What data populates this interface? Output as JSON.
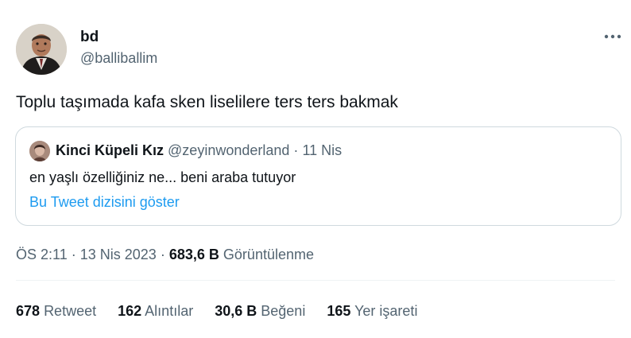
{
  "author": {
    "name": "bd",
    "handle": "@balliballim"
  },
  "tweet": {
    "text": "Toplu taşımada kafa sken liselilere ters ters bakmak"
  },
  "quoted": {
    "name": "Kinci Küpeli Kız",
    "handle": "@zeyinwonderland",
    "separator": "·",
    "date": "11 Nis",
    "text": "en yaşlı özelliğiniz ne... beni araba tutuyor",
    "thread_link": "Bu Tweet dizisini göster"
  },
  "meta": {
    "time": "ÖS 2:11",
    "separator": "·",
    "date": "13 Nis 2023",
    "views_count": "683,6 B",
    "views_label": "Görüntülenme"
  },
  "stats": [
    {
      "count": "678",
      "label": "Retweet"
    },
    {
      "count": "162",
      "label": "Alıntılar"
    },
    {
      "count": "30,6 B",
      "label": "Beğeni"
    },
    {
      "count": "165",
      "label": "Yer işareti"
    }
  ],
  "icons": {
    "more": "more-horizontal-icon"
  },
  "colors": {
    "text_primary": "#0f1419",
    "text_secondary": "#536471",
    "link": "#1d9bf0",
    "border": "#cfd9de"
  }
}
